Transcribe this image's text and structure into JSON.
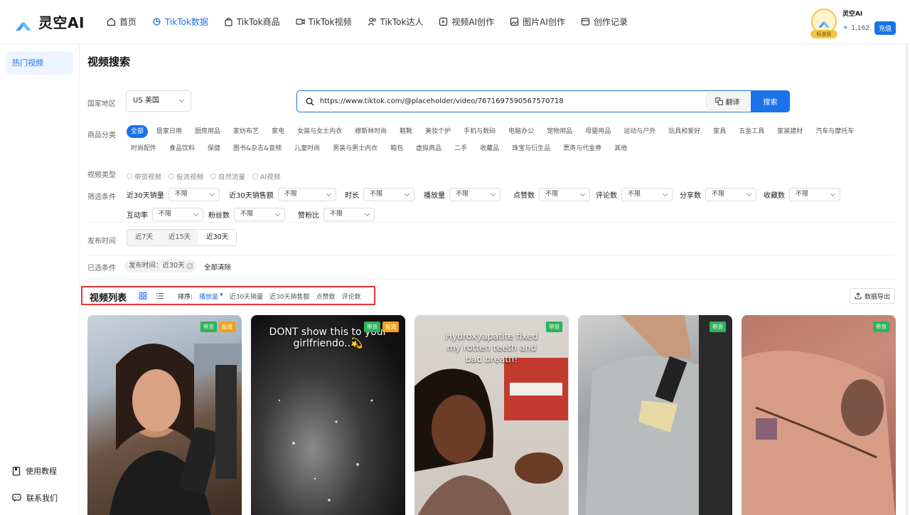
{
  "brand": {
    "name": "灵空AI"
  },
  "nav": [
    {
      "label": "首页",
      "icon": "home-icon"
    },
    {
      "label": "TikTok数据",
      "icon": "data-icon",
      "active": true
    },
    {
      "label": "TikTok商品",
      "icon": "bag-icon"
    },
    {
      "label": "TikTok视频",
      "icon": "video-icon"
    },
    {
      "label": "TikTok达人",
      "icon": "users-icon"
    },
    {
      "label": "视频AI创作",
      "icon": "ai-video-icon"
    },
    {
      "label": "图片AI创作",
      "icon": "image-icon"
    },
    {
      "label": "创作记录",
      "icon": "record-icon"
    }
  ],
  "user": {
    "name": "灵空AI",
    "badge": "标准版",
    "credits": "1,162",
    "recharge": "充值"
  },
  "sidebar": {
    "item": "热门视频",
    "tutorial": "使用教程",
    "contact": "联系我们"
  },
  "page": {
    "title": "视频搜索"
  },
  "region": {
    "label": "国家地区",
    "value": "US  美国"
  },
  "search": {
    "value": "https://www.tiktok.com/@placeholder/video/7671697590567570718",
    "translate": "翻译",
    "button": "搜索"
  },
  "category": {
    "label": "商品分类",
    "items": [
      "全部",
      "居家日用",
      "厨房用品",
      "家纺布艺",
      "家电",
      "女装与女士内衣",
      "穆斯林时尚",
      "鞋靴",
      "美妆个护",
      "手机与数码",
      "电脑办公",
      "宠物用品",
      "母婴用品",
      "运动与户外",
      "玩具和爱好",
      "家具",
      "五金工具",
      "家装建材",
      "汽车与摩托车",
      "时尚配件",
      "食品饮料",
      "保健",
      "图书&杂志&音频",
      "儿童时尚",
      "男装与男士内衣",
      "箱包",
      "虚拟商品",
      "二手",
      "收藏品",
      "珠宝与衍生品",
      "票务与代金券",
      "其他"
    ]
  },
  "video_type": {
    "label": "视频类型",
    "items": [
      "带货视频",
      "投流视频",
      "自然流量",
      "AI视频"
    ]
  },
  "filters": {
    "label": "筛选条件",
    "row1": [
      {
        "name": "近30天销量",
        "value": "不限"
      },
      {
        "name": "近30天销售额",
        "value": "不限"
      },
      {
        "name": "时长",
        "value": "不限"
      },
      {
        "name": "播放量",
        "value": "不限"
      },
      {
        "name": "点赞数",
        "value": "不限"
      },
      {
        "name": "评论数",
        "value": "不限"
      },
      {
        "name": "分享数",
        "value": "不限"
      },
      {
        "name": "收藏数",
        "value": "不限"
      }
    ],
    "row2": [
      {
        "name": "互动率",
        "value": "不限"
      },
      {
        "name": "粉丝数",
        "value": "不限"
      },
      {
        "name": "赞粉比",
        "value": "不限"
      }
    ]
  },
  "publish": {
    "label": "发布时间",
    "options": [
      "近7天",
      "近15天",
      "近30天"
    ],
    "selected": "近30天"
  },
  "selected": {
    "label": "已选条件",
    "chip": "发布时间：近30天",
    "clear": "全部清除"
  },
  "list": {
    "title": "视频列表",
    "sort_label": "排序:",
    "sort_options": [
      "播放量",
      "近30天销量",
      "近30天销售额",
      "点赞数",
      "评论数"
    ],
    "export": "数据导出"
  },
  "videos": [
    {
      "badges": [
        "带货",
        "投流"
      ],
      "caption": ""
    },
    {
      "badges": [
        "带货",
        "投流"
      ],
      "caption": "DONT show this to your girlfriendo..💫"
    },
    {
      "badges": [
        "带货"
      ],
      "caption": "Hydroxyapatite fixed my rotten teeth and bad breath!"
    },
    {
      "badges": [
        "带货"
      ],
      "caption": ""
    },
    {
      "badges": [
        "带货"
      ],
      "caption": ""
    }
  ]
}
